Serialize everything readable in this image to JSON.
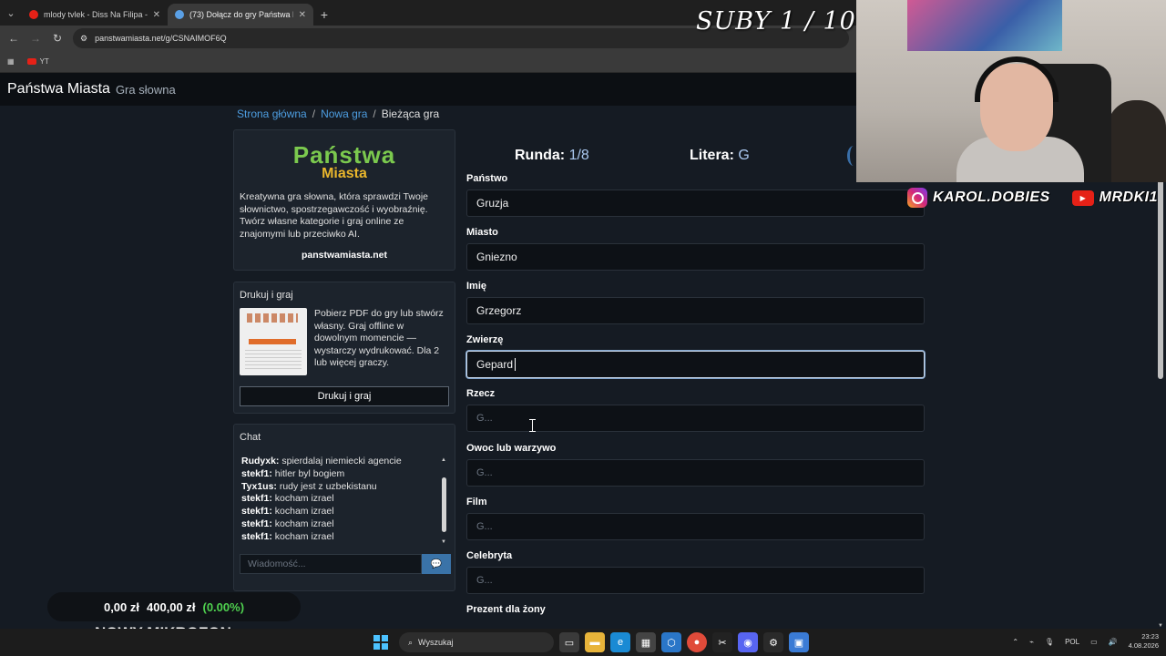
{
  "browser": {
    "tabs": [
      {
        "title": "mlody tvlek - Diss Na Filipa - Y...",
        "active": false,
        "favicon_color": "#e62117"
      },
      {
        "title": "(73) Dołącz do gry Państwa Mia...",
        "active": true,
        "favicon_color": "#5aa0e6"
      }
    ],
    "url": "panstwamiasta.net/g/CSNAIMOF6Q",
    "bookmark": "YT"
  },
  "site": {
    "brand": "Państwa Miasta",
    "brand_sub": "Gra słowna"
  },
  "breadcrumb": {
    "home": "Strona główna",
    "new_game": "Nowa gra",
    "current": "Bieżąca gra"
  },
  "intro": {
    "logo_line1": "Państwa",
    "logo_line2": "Miasta",
    "text": "Kreatywna gra słowna, która sprawdzi Twoje słownictwo, spostrzegawczość i wyobraźnię. Twórz własne kategorie i graj online ze znajomymi lub przeciwko AI.",
    "link": "panstwamiasta.net"
  },
  "print": {
    "title": "Drukuj i graj",
    "text": "Pobierz PDF do gry lub stwórz własny. Graj offline w dowolnym momencie — wystarczy wydrukować. Dla 2 lub więcej graczy.",
    "button": "Drukuj i graj"
  },
  "chat": {
    "title": "Chat",
    "messages": [
      {
        "user": "Rudyxk:",
        "text": "spierdalaj niemiecki agencie"
      },
      {
        "user": "stekf1:",
        "text": "hitler byl bogiem"
      },
      {
        "user": "Tyx1us:",
        "text": "rudy jest z uzbekistanu"
      },
      {
        "user": "stekf1:",
        "text": "kocham izrael"
      },
      {
        "user": "stekf1:",
        "text": "kocham izrael"
      },
      {
        "user": "stekf1:",
        "text": "kocham izrael"
      },
      {
        "user": "stekf1:",
        "text": "kocham izrael"
      }
    ],
    "input_placeholder": "Wiadomość..."
  },
  "game": {
    "round_label": "Runda:",
    "round_value": "1/8",
    "letter_label": "Litera:",
    "letter_value": "G",
    "fields": [
      {
        "label": "Państwo",
        "value": "Gruzja",
        "placeholder": ""
      },
      {
        "label": "Miasto",
        "value": "Gniezno",
        "placeholder": ""
      },
      {
        "label": "Imię",
        "value": "Grzegorz",
        "placeholder": ""
      },
      {
        "label": "Zwierzę",
        "value": "Gepard",
        "placeholder": "",
        "focused": true
      },
      {
        "label": "Rzecz",
        "value": "",
        "placeholder": "G..."
      },
      {
        "label": "Owoc lub warzywo",
        "value": "",
        "placeholder": "G..."
      },
      {
        "label": "Film",
        "value": "",
        "placeholder": "G..."
      },
      {
        "label": "Celebryta",
        "value": "",
        "placeholder": "G..."
      },
      {
        "label": "Prezent dla żony",
        "value": "",
        "placeholder": ""
      }
    ]
  },
  "overlay": {
    "suby": "SUBY 1 / 10",
    "instagram": "KAROL.DOBIES",
    "youtube": "MRDKI1",
    "money_current": "0,00 zł",
    "money_target": "400,00 zł",
    "money_pct": "(0.00%)",
    "mikrofon": "NOWY MIKROFON"
  },
  "taskbar": {
    "search": "Wyszukaj",
    "lang": "POL",
    "time": "23:23",
    "date": "4.08.2026"
  }
}
